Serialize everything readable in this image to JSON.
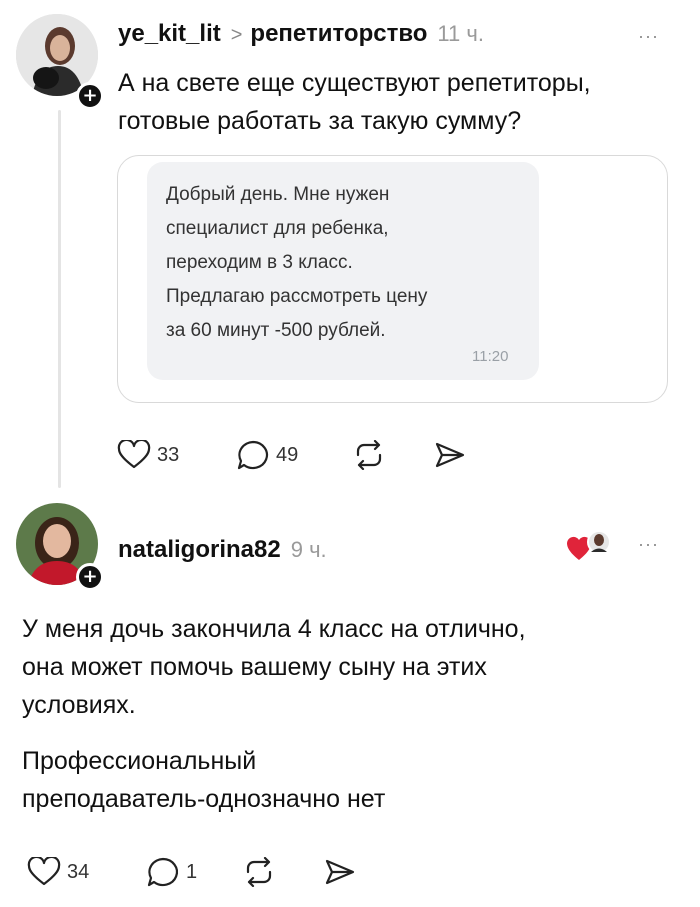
{
  "post": {
    "username": "ye_kit_lit",
    "breadcrumb_separator": ">",
    "topic": "репетиторство",
    "time": "11 ч.",
    "more": "···",
    "text_line1": "А на свете еще существуют репетиторы,",
    "text_line2": "готовые работать за такую сумму?",
    "quote": {
      "lines": [
        "Добрый день. Мне нужен",
        "специалист для ребенка,",
        "переходим в 3 класс.",
        "Предлагаю рассмотреть цену",
        "за 60 минут -500 рублей."
      ],
      "time": "11:20"
    },
    "likes": "33",
    "comments": "49"
  },
  "reply": {
    "username": "nataligorina82",
    "time": "9 ч.",
    "more": "···",
    "paragraph1_lines": [
      "У меня дочь закончила 4 класс на отлично,",
      "она может помочь вашему сыну на этих",
      "условиях."
    ],
    "paragraph2_lines": [
      "Профессиональный",
      "преподаватель-однозначно нет"
    ],
    "likes": "34",
    "comments": "1"
  },
  "icons": {
    "like": "heart-outline-icon",
    "comment": "comment-bubble-icon",
    "repost": "repost-icon",
    "share": "send-icon",
    "liked_by_author": "heart-filled-icon"
  },
  "colors": {
    "accent_heart": "#e0243a",
    "muted": "#9a9a9a"
  }
}
